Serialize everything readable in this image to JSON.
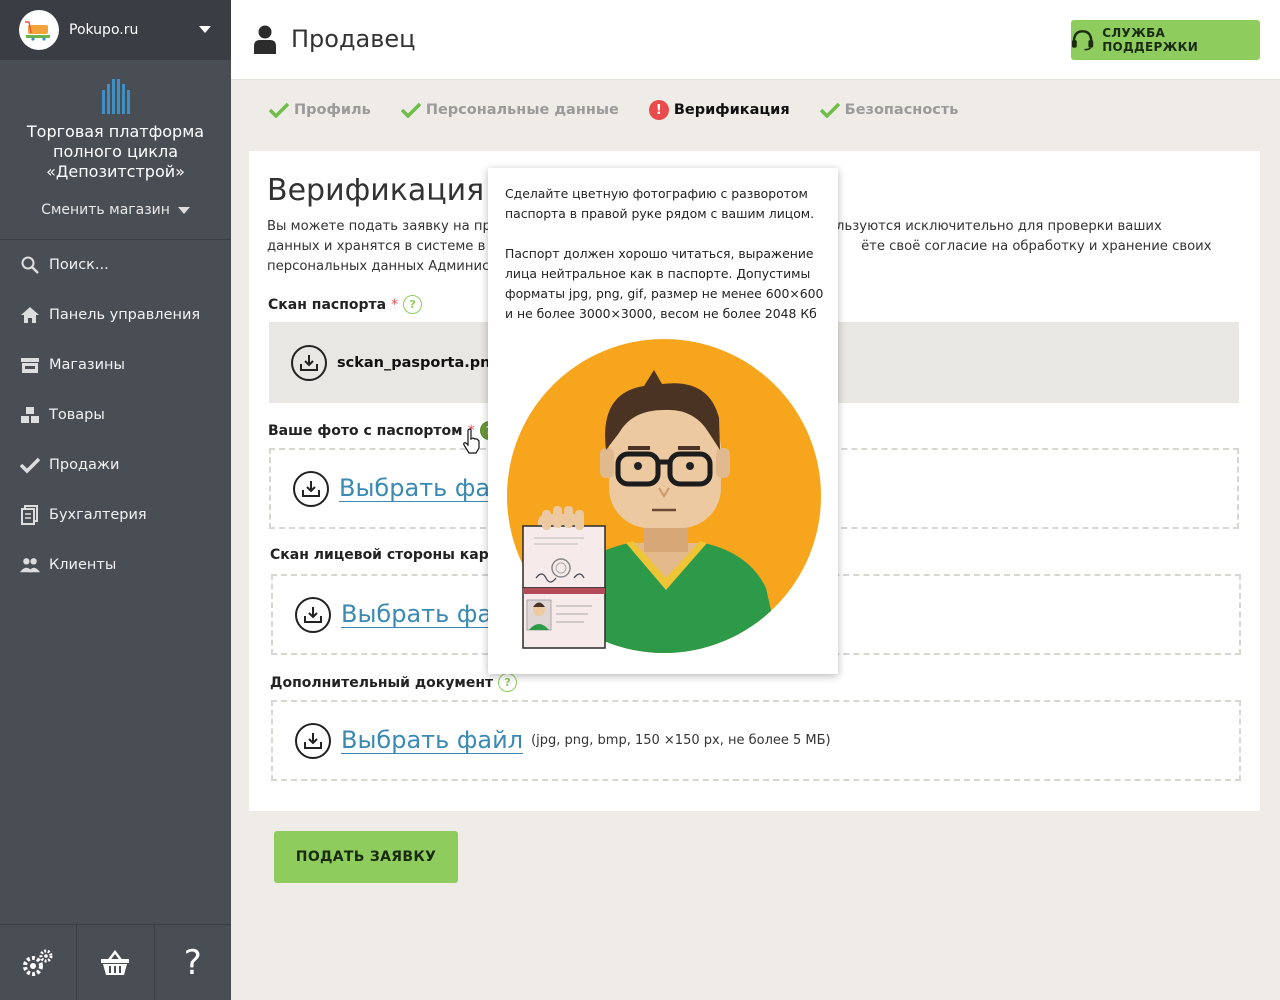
{
  "store": {
    "name": "Pokupo.ru"
  },
  "platform": {
    "title": "Торговая платформа полного цикла «Депозитстрой»",
    "switch_label": "Сменить магазин"
  },
  "nav": [
    {
      "label": "Поиск...",
      "icon": "search-icon"
    },
    {
      "label": "Панель управления",
      "icon": "home-icon"
    },
    {
      "label": "Магазины",
      "icon": "store-icon"
    },
    {
      "label": "Товары",
      "icon": "boxes-icon"
    },
    {
      "label": "Продажи",
      "icon": "check-icon"
    },
    {
      "label": "Бухгалтерия",
      "icon": "documents-icon"
    },
    {
      "label": "Клиенты",
      "icon": "users-icon"
    }
  ],
  "footer": {
    "settings_icon": "gear-icon",
    "basket_icon": "basket-icon",
    "help_label": "?"
  },
  "header": {
    "title": "Продавец",
    "support_label": "СЛУЖБА ПОДДЕРЖКИ"
  },
  "tabs": [
    {
      "label": "Профиль",
      "status": "done"
    },
    {
      "label": "Персональные данные",
      "status": "done"
    },
    {
      "label": "Верификация",
      "status": "error"
    },
    {
      "label": "Безопасность",
      "status": "done"
    }
  ],
  "tab_error_badge": "!",
  "colors": {
    "accent_green": "#8ecc5e",
    "link_blue": "#3a8ab3",
    "error_red": "#e84c4c",
    "sidebar": "#494d54"
  },
  "verification": {
    "title": "Верификация",
    "intro_a": "Вы можете подать заявку на прове",
    "intro_b": "кументы используются исключительно для проверки ваших",
    "intro_c": "данных и хранятся в системе в защ",
    "intro_d": "ёте своё согласие на обработку и хранение своих",
    "intro_e": "персональных данных Администрат",
    "help_mark": "?",
    "required_mark": "*",
    "fields": {
      "passport_scan": {
        "label": "Скан паспорта",
        "file": "sckan_pasporta.png"
      },
      "photo_with_passport": {
        "label": "Ваше фото с паспортом",
        "choose": "Выбрать файл"
      },
      "card_front": {
        "label": "Скан лицевой стороны карты",
        "choose": "Выбрать файл"
      },
      "additional_doc": {
        "label": "Дополнительный документ",
        "choose": "Выбрать файл",
        "hint": "(jpg, png, bmp, 150 ×150 px, не более 5 МБ)"
      }
    },
    "submit_label": "ПОДАТЬ ЗАЯВКУ"
  },
  "tooltip": {
    "p1": "Сделайте цветную фотографию с разворотом паспорта в правой руке рядом с вашим лицом.",
    "p2": "Паспорт должен хорошо читаться, выражение лица нейтральное как в паспорте. Допустимы форматы jpg, png, gif, размер не менее 600×600 и не более 3000×3000, весом не более 2048 Кб"
  }
}
